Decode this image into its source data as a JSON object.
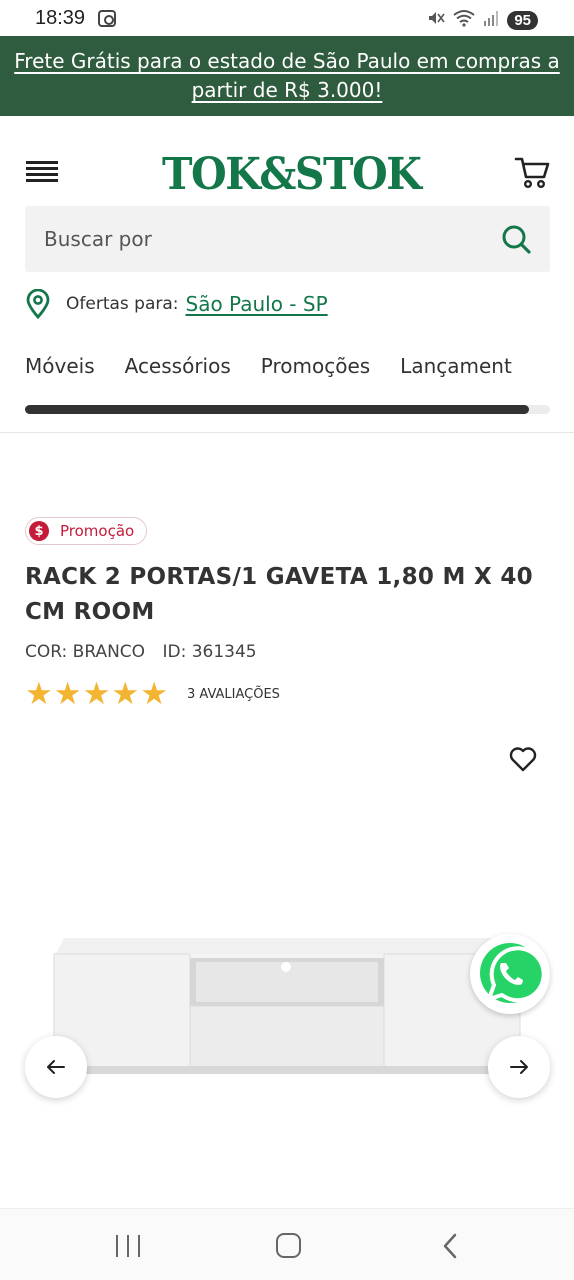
{
  "status_bar": {
    "time": "18:39",
    "battery": "95",
    "icons": [
      "screenshot-icon",
      "mute-icon",
      "wifi-icon",
      "signal-icon"
    ]
  },
  "promo_banner": {
    "text": "Frete Grátis para o estado de São Paulo em compras a partir de R$ 3.000!"
  },
  "header": {
    "logo": "TOK&STOK",
    "search_placeholder": "Buscar por",
    "location_label": "Ofertas para:",
    "location_value": "São Paulo - SP",
    "nav_tabs": [
      "Móveis",
      "Acessórios",
      "Promoções",
      "Lançament"
    ],
    "nav_scroll_progress": 0.96
  },
  "product": {
    "badge": "Promoção",
    "title": "RACK 2 PORTAS/1 GAVETA 1,80 M X 40 CM ROOM",
    "color": "COR: BRANCO",
    "id": "ID: 361345",
    "rating": 5,
    "reviews": "3 AVALIAÇÕES"
  },
  "colors": {
    "brand_green": "#14774a",
    "banner_green": "#2f5b3e",
    "promo_red": "#c41b3b",
    "star_yellow": "#f2b431",
    "whatsapp_green": "#25d366"
  }
}
